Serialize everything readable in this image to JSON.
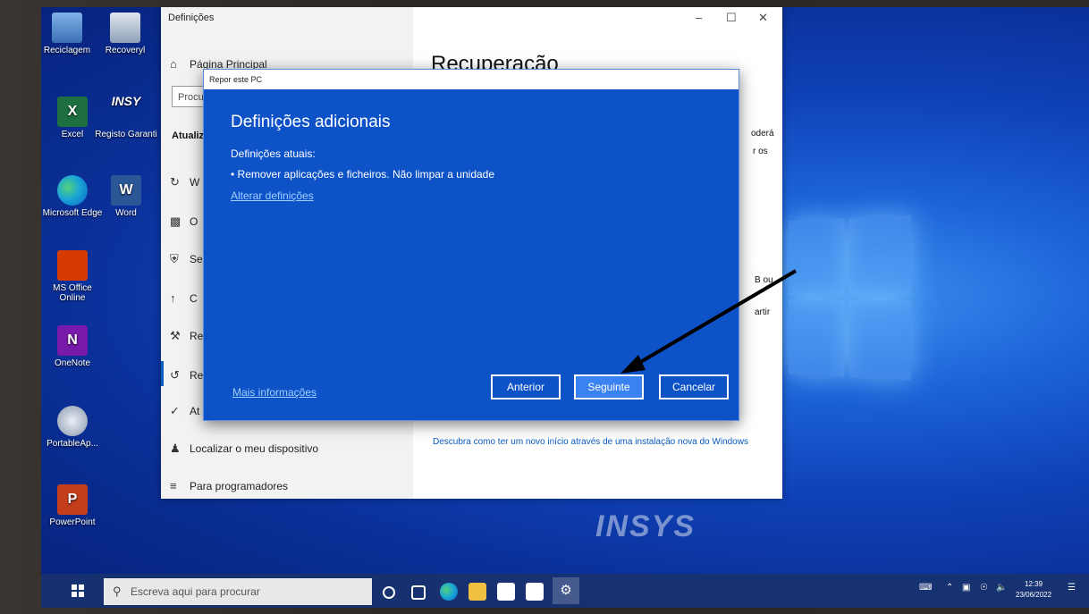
{
  "desktop": {
    "icons": [
      {
        "label": "Reciclagem",
        "icon": "recycle-bin-icon"
      },
      {
        "label": "Recoveryl",
        "icon": "recovery-icon"
      },
      {
        "label": "Excel",
        "icon": "excel-icon"
      },
      {
        "label": "Registo Garanti",
        "icon": "insys-icon"
      },
      {
        "label": "Microsoft Edge",
        "icon": "edge-icon"
      },
      {
        "label": "Word",
        "icon": "word-icon"
      },
      {
        "label": "MS Office Online",
        "icon": "office-icon"
      },
      {
        "label": "OneNote",
        "icon": "onenote-icon"
      },
      {
        "label": "PortableAp...",
        "icon": "portableapps-icon"
      },
      {
        "label": "PowerPoint",
        "icon": "powerpoint-icon"
      }
    ],
    "insys_small": "INSY",
    "brand_watermark": "INSYS"
  },
  "settings": {
    "window_title": "Definições",
    "home_label": "Página Principal",
    "search_placeholder": "Procu",
    "section_label": "Atualiz",
    "nav_partial": [
      "W",
      "O",
      "Se",
      "C",
      "Re",
      "Re",
      "At"
    ],
    "nav_find_device": "Localizar o meu dispositivo",
    "nav_developers": "Para programadores",
    "page_title": "Recuperação",
    "right_fragments": [
      "oderá",
      "r os",
      "B ou",
      "artir"
    ],
    "fresh_start_link": "Descubra como ter um novo início através de uma instalação nova do Windows"
  },
  "dialog": {
    "title": "Repor este PC",
    "heading": "Definições adicionais",
    "current_label": "Definições atuais:",
    "current_value": "• Remover aplicações e ficheiros. Não limpar a unidade",
    "change_link": "Alterar definições",
    "more_info": "Mais informações",
    "btn_back": "Anterior",
    "btn_next": "Seguinte",
    "btn_cancel": "Cancelar"
  },
  "taskbar": {
    "search_placeholder": "Escreva aqui para procurar",
    "time": "12:39",
    "date": "23/06/2022"
  }
}
